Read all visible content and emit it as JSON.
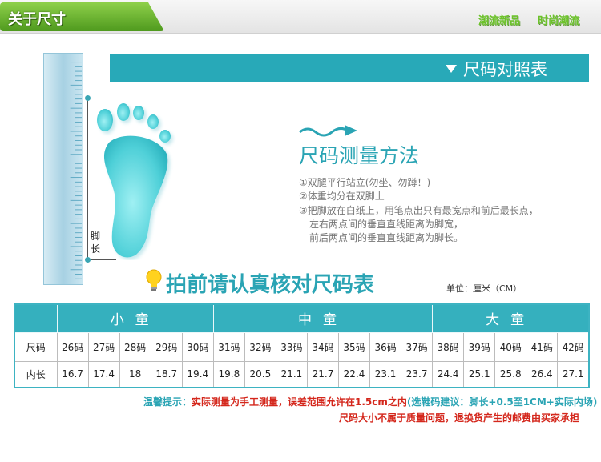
{
  "header": {
    "title": "关于尺寸",
    "slogans": [
      "潮流新品",
      "时尚潮流"
    ]
  },
  "size_chart_banner": {
    "title": "尺码对照表"
  },
  "measure": {
    "foot_length_label": "脚长",
    "method_title": "尺码测量方法",
    "steps": [
      "①双腿平行站立(勿坐、勿蹲！)",
      "②体重均分在双脚上",
      "③把脚放在白纸上，用笔点出只有最宽点和前后最长点，",
      "左右两点间的垂直直线距离为脚宽，",
      "前后两点间的垂直直线距离为脚长。"
    ]
  },
  "confirm": {
    "title": "拍前请认真核对尺码表",
    "unit": "单位：厘米（CM）"
  },
  "table": {
    "groups": [
      "小童",
      "中童",
      "大童"
    ],
    "row_labels": {
      "size": "尺码",
      "length": "内长"
    },
    "sizes": [
      "26码",
      "27码",
      "28码",
      "29码",
      "30码",
      "31码",
      "32码",
      "33码",
      "34码",
      "35码",
      "36码",
      "37码",
      "38码",
      "39码",
      "40码",
      "41码",
      "42码"
    ],
    "lengths": [
      "16.7",
      "17.4",
      "18",
      "18.7",
      "19.4",
      "19.8",
      "20.5",
      "21.1",
      "21.7",
      "22.4",
      "23.1",
      "23.7",
      "24.4",
      "25.1",
      "25.8",
      "26.4",
      "27.1"
    ]
  },
  "notes": {
    "line1_prefix": "温馨提示：",
    "line1_body": "实际测量为手工测量，误差范围允许在1.5cm之内",
    "line1_tip": "(选鞋码建议：脚长+0.5至1CM+实际内场)",
    "line2": "尺码大小不属于质量问题，退换货产生的邮费由买家承担"
  },
  "colors": {
    "accent_teal": "#2aa4b4",
    "header_green": "#5aa82a",
    "warning_red": "#d4271c"
  }
}
